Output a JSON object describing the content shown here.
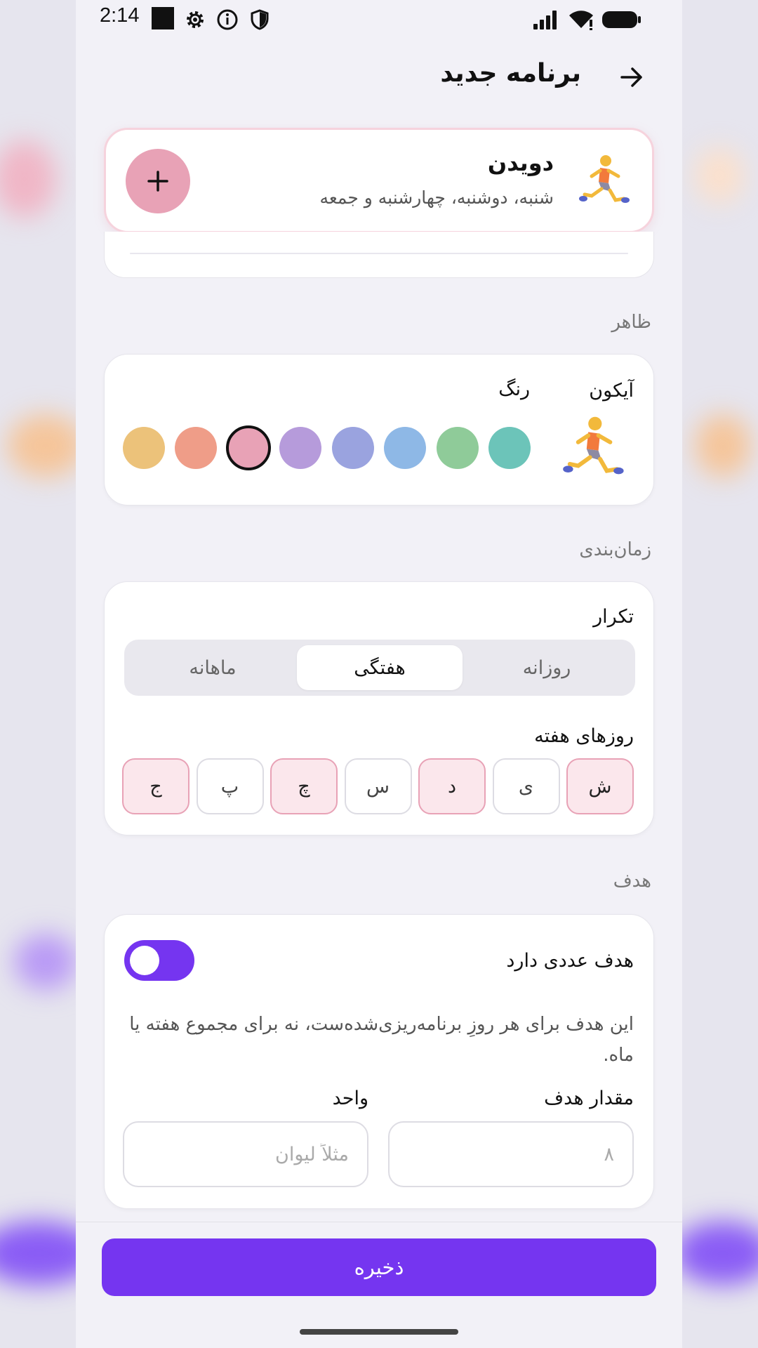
{
  "status_bar": {
    "time": "2:14",
    "icons": [
      "square-icon",
      "gear-icon",
      "info-icon",
      "shield-icon",
      "signal-icon",
      "wifi-icon",
      "battery-icon"
    ]
  },
  "header": {
    "title": "برنامه جدید",
    "back_icon": "arrow-right-icon"
  },
  "preview": {
    "icon": "person-running-emoji",
    "name": "دویدن",
    "days": "شنبه، دوشنبه، چهارشنبه و جمعه",
    "add_icon": "plus-icon",
    "color": "#e8a2b6"
  },
  "appearance": {
    "section_label": "ظاهر",
    "icon_label": "آیکون",
    "color_label": "رنگ",
    "icon": "person-running-emoji",
    "colors": [
      "#6cc4b9",
      "#8fcb99",
      "#8eb8e6",
      "#9aa3df",
      "#b69bdb",
      "#e8a2b6",
      "#ef9d88",
      "#ecc27a"
    ],
    "selected_color": "#e8a2b6"
  },
  "schedule": {
    "section_label": "زمان‌بندی",
    "repeat_label": "تکرار",
    "repeat_options": [
      "روزانه",
      "هفتگی",
      "ماهانه"
    ],
    "repeat_selected": "هفتگی",
    "weekdays_label": "روزهای هفته",
    "days": [
      {
        "label": "ش",
        "selected": true
      },
      {
        "label": "ی",
        "selected": false
      },
      {
        "label": "د",
        "selected": true
      },
      {
        "label": "س",
        "selected": false
      },
      {
        "label": "چ",
        "selected": true
      },
      {
        "label": "پ",
        "selected": false
      },
      {
        "label": "ج",
        "selected": true
      }
    ]
  },
  "goal": {
    "section_label": "هدف",
    "has_goal_label": "هدف عددی دارد",
    "has_goal": true,
    "description": "این هدف برای هر روزِ برنامه‌ریزی‌شده‌ست، نه برای مجموع هفته یا ماه.",
    "amount_label": "مقدار هدف",
    "amount_placeholder": "۸",
    "unit_label": "واحد",
    "unit_placeholder": "مثلاً لیوان"
  },
  "footer": {
    "save_label": "ذخیره"
  },
  "colors": {
    "accent": "#7535f0",
    "habit_pink": "#e8a2b6",
    "selected_day_bg": "#fbe7ec"
  }
}
